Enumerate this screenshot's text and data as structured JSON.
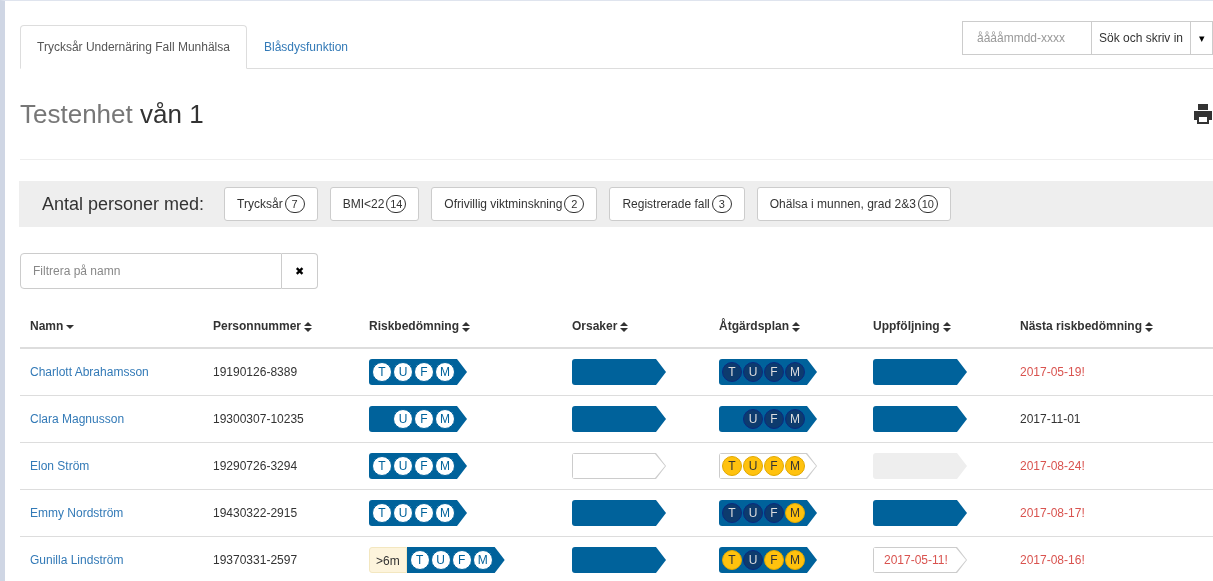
{
  "tabs": [
    {
      "label": "Trycksår Undernäring Fall Munhälsa",
      "selected": true
    },
    {
      "label": "Blåsdysfunktion",
      "selected": false
    }
  ],
  "search": {
    "placeholder": "ååååmmdd-xxxx",
    "button": "Sök och skriv in",
    "caret": "▾"
  },
  "heading": {
    "unit": "Testenhet",
    "ward": "vån 1"
  },
  "summary": {
    "label": "Antal personer med:",
    "filters": [
      {
        "label": "Trycksår",
        "count": "7"
      },
      {
        "label": "BMI<22",
        "count": "14"
      },
      {
        "label": "Ofrivillig viktminskning",
        "count": "2"
      },
      {
        "label": "Registrerade fall",
        "count": "3"
      },
      {
        "label": "Ohälsa i munnen, grad 2&3",
        "count": "10"
      }
    ]
  },
  "filter": {
    "placeholder": "Filtrera på namn",
    "clear": "✖"
  },
  "table": {
    "columns": [
      {
        "label": "Namn",
        "sorted": true
      },
      {
        "label": "Personnummer",
        "sorted": false
      },
      {
        "label": "Riskbedömning",
        "sorted": false
      },
      {
        "label": "Orsaker",
        "sorted": false
      },
      {
        "label": "Åtgärdsplan",
        "sorted": false
      },
      {
        "label": "Uppföljning",
        "sorted": false
      },
      {
        "label": "Nästa riskbedömning",
        "sorted": false
      }
    ],
    "rows": [
      {
        "name": "Charlott Abrahamsson",
        "pnr": "19190126-8389",
        "risk": {
          "circles": [
            "T",
            "U",
            "F",
            "M"
          ]
        },
        "causes": {
          "kind": "filled"
        },
        "plan": {
          "kind": "filled",
          "circles": [
            {
              "letter": "T",
              "done": true
            },
            {
              "letter": "U",
              "done": true
            },
            {
              "letter": "F",
              "done": true
            },
            {
              "letter": "M",
              "done": true
            }
          ]
        },
        "followup": {
          "kind": "filled"
        },
        "next": {
          "text": "2017-05-19!",
          "overdue": true
        }
      },
      {
        "name": "Clara Magnusson",
        "pnr": "19300307-10235",
        "risk": {
          "circles": [
            "U",
            "F",
            "M"
          ]
        },
        "causes": {
          "kind": "filled"
        },
        "plan": {
          "kind": "filled",
          "circles": [
            {
              "letter": "U",
              "done": true
            },
            {
              "letter": "F",
              "done": true
            },
            {
              "letter": "M",
              "done": true
            }
          ]
        },
        "followup": {
          "kind": "filled"
        },
        "next": {
          "text": "2017-11-01",
          "overdue": false
        }
      },
      {
        "name": "Elon Ström",
        "pnr": "19290726-3294",
        "risk": {
          "circles": [
            "T",
            "U",
            "F",
            "M"
          ]
        },
        "causes": {
          "kind": "empty"
        },
        "plan": {
          "kind": "empty",
          "circles": [
            {
              "letter": "T",
              "done": false
            },
            {
              "letter": "U",
              "done": false
            },
            {
              "letter": "F",
              "done": false
            },
            {
              "letter": "M",
              "done": false
            }
          ]
        },
        "followup": {
          "kind": "grey"
        },
        "next": {
          "text": "2017-08-24!",
          "overdue": true
        }
      },
      {
        "name": "Emmy Nordström",
        "pnr": "19430322-2915",
        "risk": {
          "circles": [
            "T",
            "U",
            "F",
            "M"
          ]
        },
        "causes": {
          "kind": "filled"
        },
        "plan": {
          "kind": "filled",
          "circles": [
            {
              "letter": "T",
              "done": true
            },
            {
              "letter": "U",
              "done": true
            },
            {
              "letter": "F",
              "done": true
            },
            {
              "letter": "M",
              "done": false
            }
          ]
        },
        "followup": {
          "kind": "filled"
        },
        "next": {
          "text": "2017-08-17!",
          "overdue": true
        }
      },
      {
        "name": "Gunilla Lindström",
        "pnr": "19370331-2597",
        "risk": {
          "prefix": ">6m",
          "circles": [
            "T",
            "U",
            "F",
            "M"
          ]
        },
        "causes": {
          "kind": "filled"
        },
        "plan": {
          "kind": "filled",
          "circles": [
            {
              "letter": "T",
              "done": false
            },
            {
              "letter": "U",
              "done": true
            },
            {
              "letter": "F",
              "done": false
            },
            {
              "letter": "M",
              "done": false
            }
          ]
        },
        "followup": {
          "kind": "text",
          "text": "2017-05-11!"
        },
        "next": {
          "text": "2017-08-16!",
          "overdue": true
        }
      }
    ]
  }
}
